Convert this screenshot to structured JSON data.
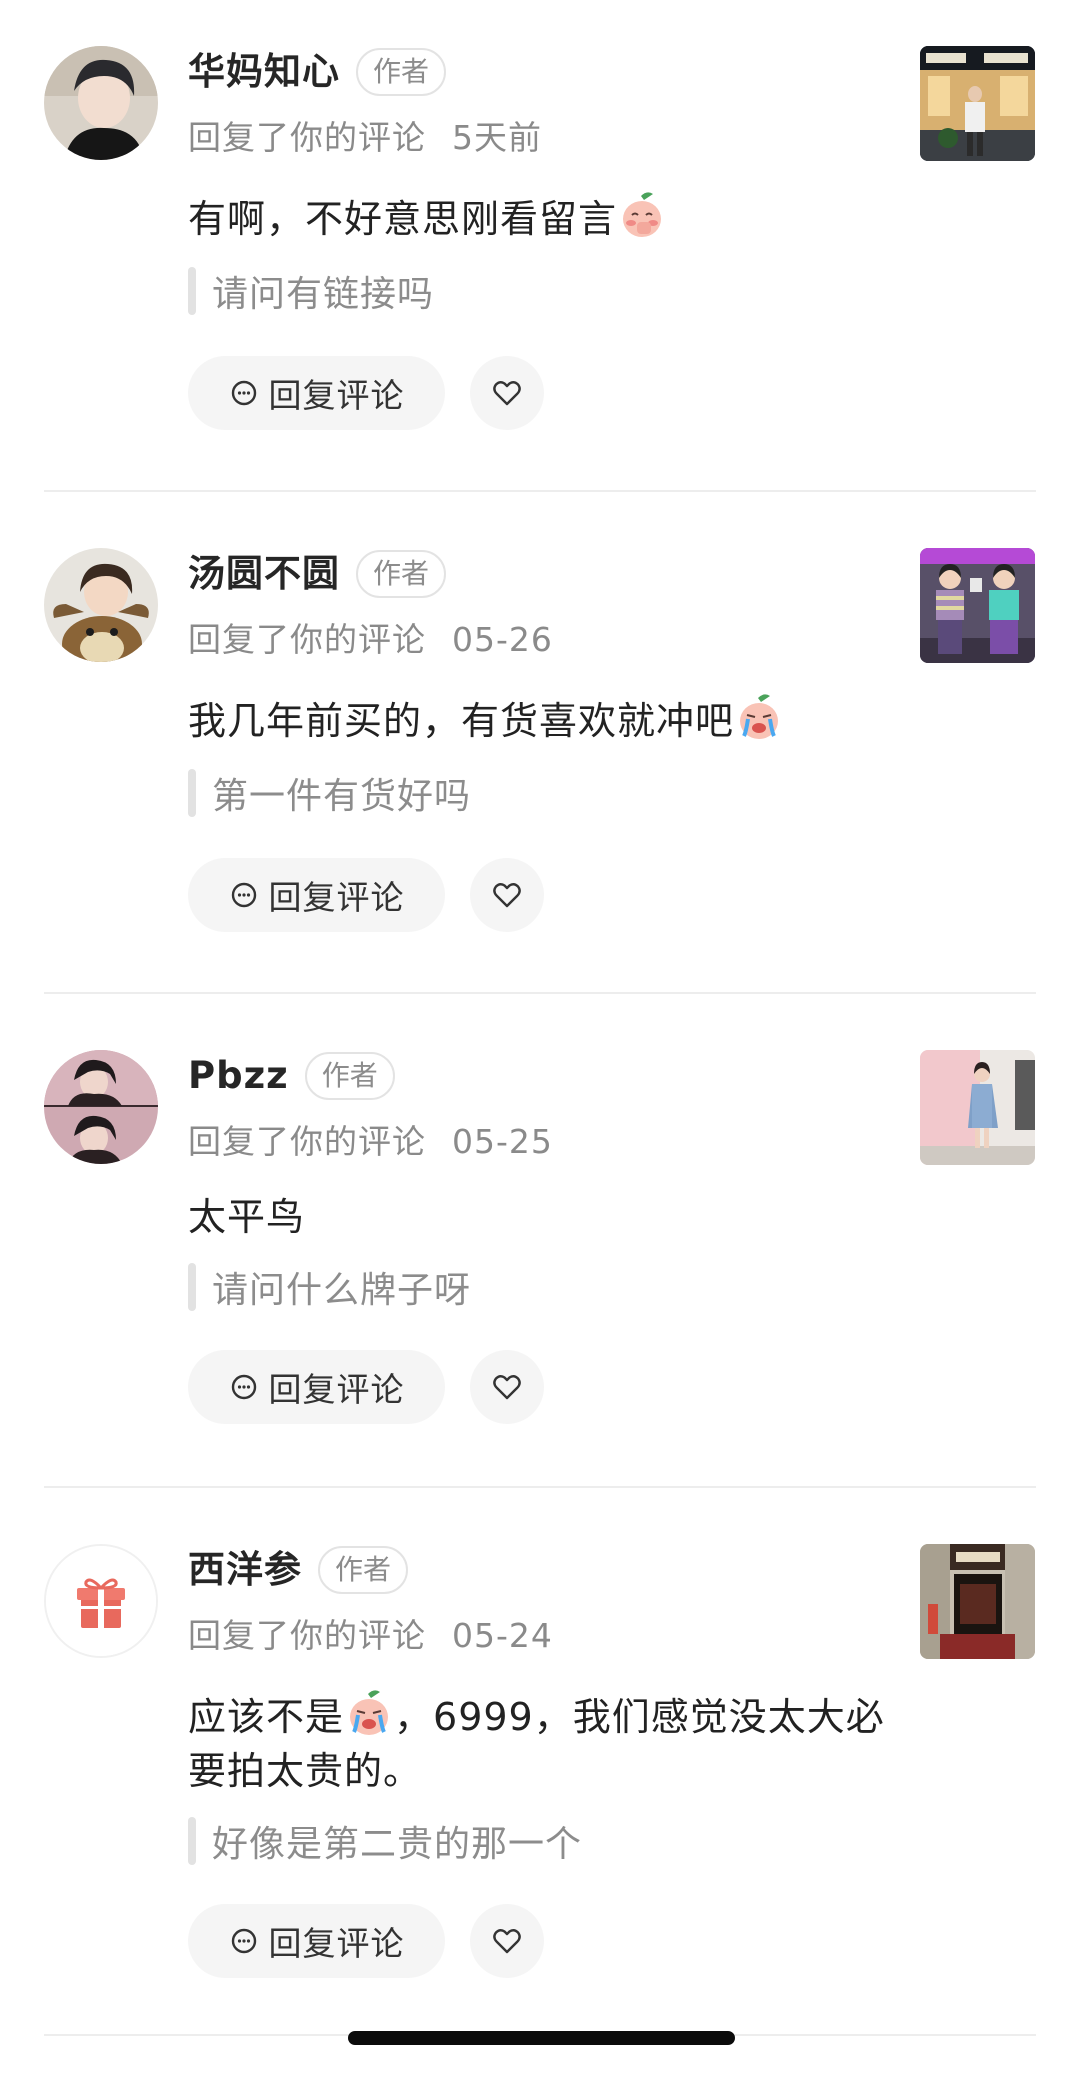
{
  "author_tag": "作者",
  "reply_label": "回复评论",
  "comments": [
    {
      "name": "华妈知心",
      "action": "回复了你的评论",
      "time": "5天前",
      "content_pre": "有啊，不好意思刚看留言",
      "content_post": "",
      "quote": "请问有链接吗"
    },
    {
      "name": "汤圆不圆",
      "action": "回复了你的评论",
      "time": "05-26",
      "content_pre": "我几年前买的，有货喜欢就冲吧",
      "content_post": "",
      "quote": "第一件有货好吗"
    },
    {
      "name": "Pbzz",
      "action": "回复了你的评论",
      "time": "05-25",
      "content_pre": "太平鸟",
      "content_post": "",
      "quote": "请问什么牌子呀"
    },
    {
      "name": "西洋参",
      "action": "回复了你的评论",
      "time": "05-24",
      "content_pre": "应该不是",
      "content_post": "，6999，我们感觉没太大必要拍太贵的。",
      "quote": "好像是第二贵的那一个"
    }
  ],
  "colors": {
    "text_primary": "#222222",
    "text_secondary": "#8a8a8a",
    "button_bg": "#f5f5f5",
    "divider": "#ededed"
  }
}
